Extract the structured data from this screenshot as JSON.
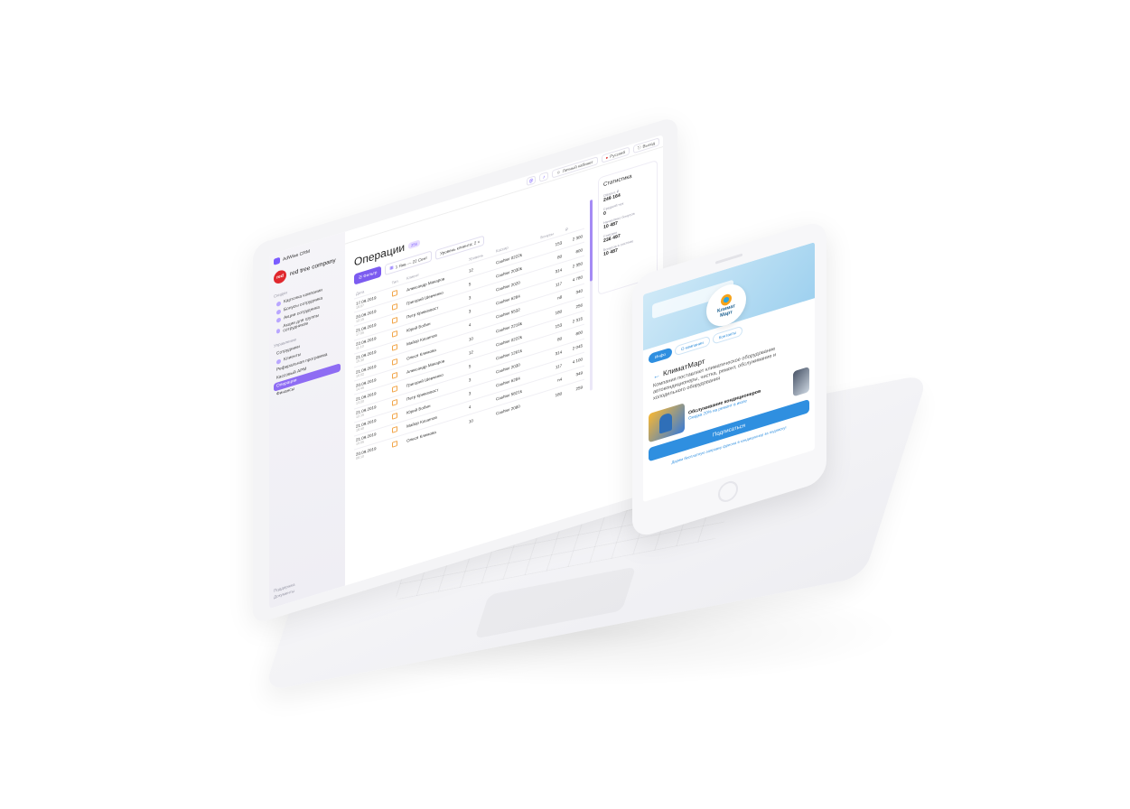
{
  "crm": {
    "app_name": "AdWise CRM",
    "company_logo_text": "red",
    "company_name": "red tree company",
    "nav_section_1": "Скидки",
    "nav_section_1_items": [
      "Карточка компании",
      "Бонусы сотрудника",
      "Акции сотрудника",
      "Акции для группы сотрудников"
    ],
    "nav_section_2": "Управление",
    "nav_section_2_items": [
      "Сотрудники",
      "Клиенты",
      "Реферальная программа",
      "Кассовый АРМ",
      "Операции",
      "Финансы"
    ],
    "active_nav": "Операции",
    "sidebar_footer": [
      "Поддержка",
      "Документы"
    ],
    "topbar": {
      "cabinet": "Личный кабинет",
      "language": "Русский",
      "logout": "Выход"
    },
    "page_title": "Операции",
    "page_badge": "256",
    "filter_button": "Фильтр",
    "date_range": "1 Янв — 22 Сент",
    "level_filter": "Уровень клиента: 2",
    "table": {
      "headers": [
        "Дата",
        "Тип",
        "Клиент",
        "Уровень",
        "Кассир",
        "Бонусы",
        "₽"
      ],
      "rows": [
        {
          "date": "17.09.2019",
          "time": "19:07",
          "client": "Александр Макаров",
          "level": "12",
          "cashier": "Cashier 0222k",
          "bonus": "153",
          "sum": "2 300"
        },
        {
          "date": "20.09.2019",
          "time": "12:15",
          "client": "Григорий Шевченко",
          "level": "5",
          "cashier": "Cashier 2030k",
          "bonus": "80",
          "sum": "800"
        },
        {
          "date": "21.09.2019",
          "time": "17:05",
          "client": "Петр Кривохвост",
          "level": "3",
          "cashier": "Cashier 2020",
          "bonus": "314",
          "sum": "2 350"
        },
        {
          "date": "22.09.2019",
          "time": "11:10",
          "client": "Юрий Бобин",
          "level": "3",
          "cashier": "Cashier 6284",
          "bonus": "117",
          "sum": "4 780"
        },
        {
          "date": "21.09.2019",
          "time": "15:30",
          "client": "Майор Кошепов",
          "level": "4",
          "cashier": "Cashier 5532",
          "bonus": "n8",
          "sum": "340"
        },
        {
          "date": "21.09.2019",
          "time": "16:02",
          "client": "Олеся Климова",
          "level": "10",
          "cashier": "Cashier 2218k",
          "bonus": "180",
          "sum": "256"
        },
        {
          "date": "20.09.2019",
          "time": "14:45",
          "client": "Александр Макаров",
          "level": "12",
          "cashier": "Cashier 0222k",
          "bonus": "153",
          "sum": "2 315"
        },
        {
          "date": "21.09.2019",
          "time": "13:20",
          "client": "Григорий Шевченко",
          "level": "5",
          "cashier": "Cashier 1261k",
          "bonus": "80",
          "sum": "800"
        },
        {
          "date": "21.09.2019",
          "time": "12:15",
          "client": "Петр Кривохвост",
          "level": "3",
          "cashier": "Cashier 2030",
          "bonus": "314",
          "sum": "2 045"
        },
        {
          "date": "21.09.2019",
          "time": "18:40",
          "client": "Юрий Бобин",
          "level": "3",
          "cashier": "Cashier 6284",
          "bonus": "117",
          "sum": "4 100"
        },
        {
          "date": "21.09.2019",
          "time": "10:05",
          "client": "Майор Кошепов",
          "level": "4",
          "cashier": "Cashier 5821k",
          "bonus": "n4",
          "sum": "349"
        },
        {
          "date": "20.09.2019",
          "time": "09:10",
          "client": "Олеся Климова",
          "level": "10",
          "cashier": "Cashier 2080",
          "bonus": "180",
          "sum": "259"
        }
      ]
    },
    "stats": {
      "title": "Статистика",
      "items": [
        {
          "label": "Оборот, ₽",
          "value": "249 164"
        },
        {
          "label": "Средний чек",
          "value": "0"
        },
        {
          "label": "Начислено бонусов",
          "value": "10 487"
        },
        {
          "label": "Списано",
          "value": "236 497"
        },
        {
          "label": "Бонусов в системе",
          "value": "10 487"
        }
      ]
    }
  },
  "phone": {
    "logo_text_1": "Климат",
    "logo_text_2": "Март",
    "tabs": [
      "Инфо",
      "О компании",
      "Контакты"
    ],
    "active_tab": "Инфо",
    "company_title": "КлиматМарт",
    "company_desc": "Компания поставляет климатическое оборудование автокондиционеры, чистка, ремонт, обслуживание и холодильного оборудования",
    "promo_title": "Обслуживание кондиционеров",
    "promo_sub": "Скидка 20% на ремонт в июле",
    "subscribe_label": "Подписаться",
    "subscribe_note": "Дарим бесплатную заправку фреона в кондиционер за подписку!"
  }
}
